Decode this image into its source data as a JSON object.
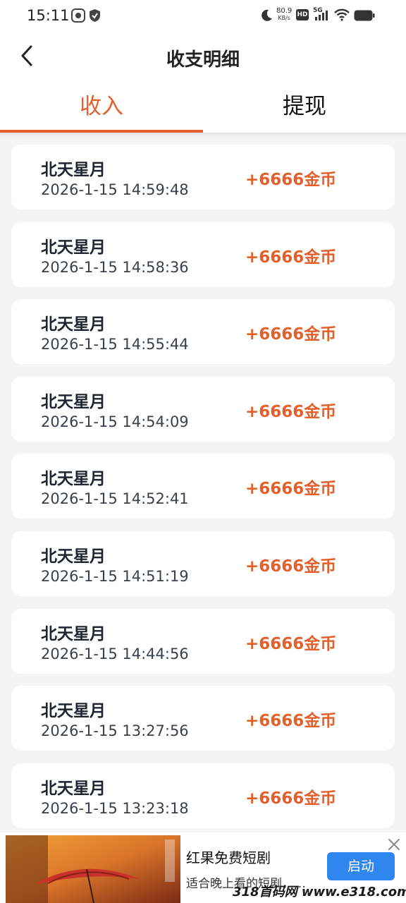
{
  "status_bar": {
    "time": "15:11",
    "net_speed_value": "80.9",
    "net_speed_unit": "KB/s",
    "hd_label": "HD",
    "network_label": "5G",
    "icons": [
      "app-notification-icon",
      "shield-icon",
      "moon-icon",
      "hd-icon",
      "signal-icon",
      "wifi-icon",
      "battery-icon"
    ]
  },
  "nav": {
    "back_icon": "chevron-left-icon",
    "title": "收支明细"
  },
  "tabs": [
    {
      "label": "收入",
      "active": true
    },
    {
      "label": "提现",
      "active": false
    }
  ],
  "records": [
    {
      "name": "北天星月",
      "time": "2026-1-15 14:59:48",
      "amount": "+6666金币"
    },
    {
      "name": "北天星月",
      "time": "2026-1-15 14:58:36",
      "amount": "+6666金币"
    },
    {
      "name": "北天星月",
      "time": "2026-1-15 14:55:44",
      "amount": "+6666金币"
    },
    {
      "name": "北天星月",
      "time": "2026-1-15 14:54:09",
      "amount": "+6666金币"
    },
    {
      "name": "北天星月",
      "time": "2026-1-15 14:52:41",
      "amount": "+6666金币"
    },
    {
      "name": "北天星月",
      "time": "2026-1-15 14:51:19",
      "amount": "+6666金币"
    },
    {
      "name": "北天星月",
      "time": "2026-1-15 14:44:56",
      "amount": "+6666金币"
    },
    {
      "name": "北天星月",
      "time": "2026-1-15 13:27:56",
      "amount": "+6666金币"
    },
    {
      "name": "北天星月",
      "time": "2026-1-15 13:23:18",
      "amount": "+6666金币"
    }
  ],
  "ad": {
    "title": "红果免费短剧",
    "description": "适合晚上看的短剧，…",
    "button_label": "启动",
    "close_icon": "close-icon"
  },
  "watermark": "318首码网 www.e318.com",
  "colors": {
    "accent": "#e35f2b",
    "button_blue": "#2f86ef",
    "background": "#f4f4f5",
    "card": "#ffffff"
  }
}
